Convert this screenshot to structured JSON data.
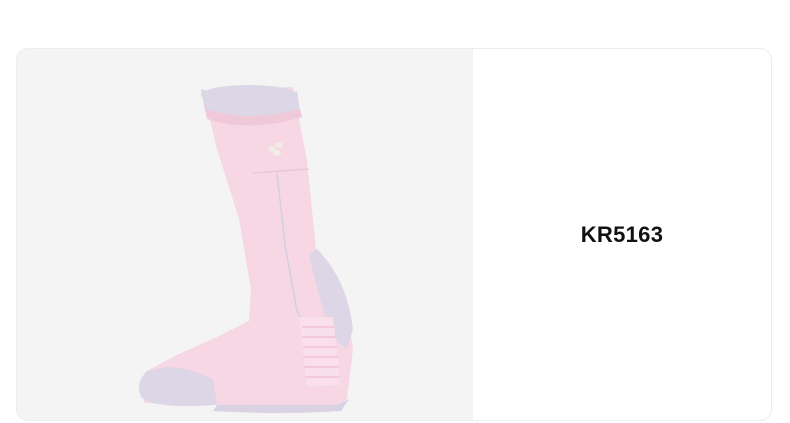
{
  "product": {
    "code": "KR5163",
    "image_icon": "sock-product-image",
    "colors": {
      "sock_body": "#f6d7e3",
      "sock_accent": "#dcd6e6",
      "panel_background": "#f4f4f4"
    }
  }
}
